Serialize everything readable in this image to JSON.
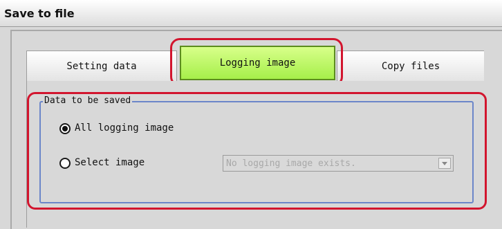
{
  "window": {
    "title": "Save to file"
  },
  "tabs": [
    {
      "label": "Setting data",
      "active": false
    },
    {
      "label": "Logging image",
      "active": true
    },
    {
      "label": "Copy files",
      "active": false
    }
  ],
  "group": {
    "label": "Data to be saved",
    "options": [
      {
        "label": "All logging image",
        "selected": true
      },
      {
        "label": "Select image",
        "selected": false
      }
    ]
  },
  "image_select": {
    "value": "No logging image exists.",
    "enabled": false
  },
  "colors": {
    "active_tab": "#b8f560",
    "highlight": "#d2152e",
    "group_border": "#6b86c9"
  }
}
